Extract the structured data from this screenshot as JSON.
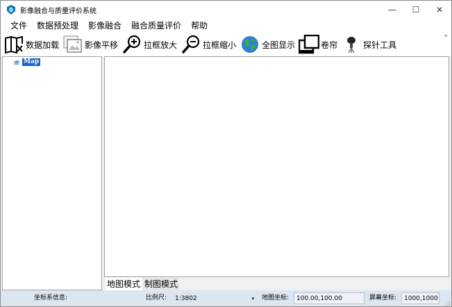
{
  "window": {
    "title": "影像融合与质量评价系统",
    "controls": {
      "minimize": "—",
      "maximize": "☐",
      "close": "✕"
    }
  },
  "menu": {
    "items": [
      "文件",
      "数据预处理",
      "影像融合",
      "融合质量评价",
      "帮助"
    ]
  },
  "toolbar": {
    "items": [
      {
        "label": "数据加载",
        "icon": "book-open-icon"
      },
      {
        "label": "影像平移",
        "icon": "pan-image-icon"
      },
      {
        "label": "拉框放大",
        "icon": "zoom-in-icon"
      },
      {
        "label": "拉框缩小",
        "icon": "zoom-out-icon"
      },
      {
        "label": "全图显示",
        "icon": "globe-icon"
      },
      {
        "label": "卷帘",
        "icon": "swipe-window-icon"
      },
      {
        "label": "探针工具",
        "icon": "probe-icon"
      }
    ],
    "overflow": "»"
  },
  "tree": {
    "root_label": "Map"
  },
  "tabs": {
    "items": [
      "地图模式",
      "制图模式"
    ]
  },
  "status": {
    "coord_system_label": "坐标系信息:",
    "scale_label": "比例尺:",
    "scale_value": "1:3802",
    "map_coord_label": "地图坐标:",
    "map_coord_value": "100.00,100.00",
    "screen_coord_label": "屏幕坐标:",
    "screen_coord_value": "1000,1000"
  },
  "colors": {
    "selection": "#1e64c8",
    "statusbar": "#dce6f0"
  }
}
